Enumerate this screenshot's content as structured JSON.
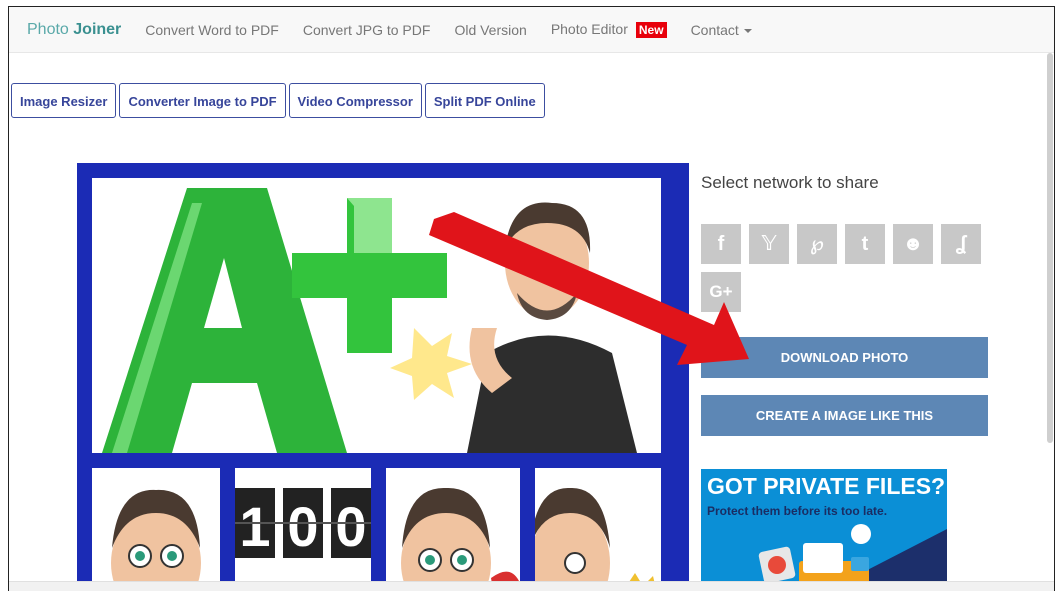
{
  "navbar": {
    "brand_light": "Photo",
    "brand_bold": "Joiner",
    "links": [
      "Convert Word to PDF",
      "Convert JPG to PDF",
      "Old Version",
      "Photo Editor"
    ],
    "new_badge": "New",
    "contact": "Contact"
  },
  "tools": [
    "Image Resizer",
    "Converter Image to PDF",
    "Video Compressor",
    "Split PDF Online"
  ],
  "collage": {
    "tile_text": "100"
  },
  "share": {
    "title": "Select network to share",
    "buttons": [
      {
        "glyph": "f",
        "icon": "facebook-icon"
      },
      {
        "glyph": "𝕐",
        "icon": "twitter-icon"
      },
      {
        "glyph": "℘",
        "icon": "pinterest-icon"
      },
      {
        "glyph": "t",
        "icon": "tumblr-icon"
      },
      {
        "glyph": "☻",
        "icon": "reddit-icon"
      },
      {
        "glyph": "ʆ",
        "icon": "stumbleupon-icon"
      },
      {
        "glyph": "G+",
        "icon": "google-plus-icon"
      }
    ]
  },
  "actions": {
    "download": "DOWNLOAD PHOTO",
    "create": "CREATE A IMAGE LIKE THIS"
  },
  "ad": {
    "title": "GOT PRIVATE FILES?",
    "subtitle": "Protect them before its too late."
  },
  "colors": {
    "collage_border": "#1b2bb5",
    "cta": "#5d87b5",
    "badge": "#e8000b",
    "arrow": "#e0141a"
  }
}
